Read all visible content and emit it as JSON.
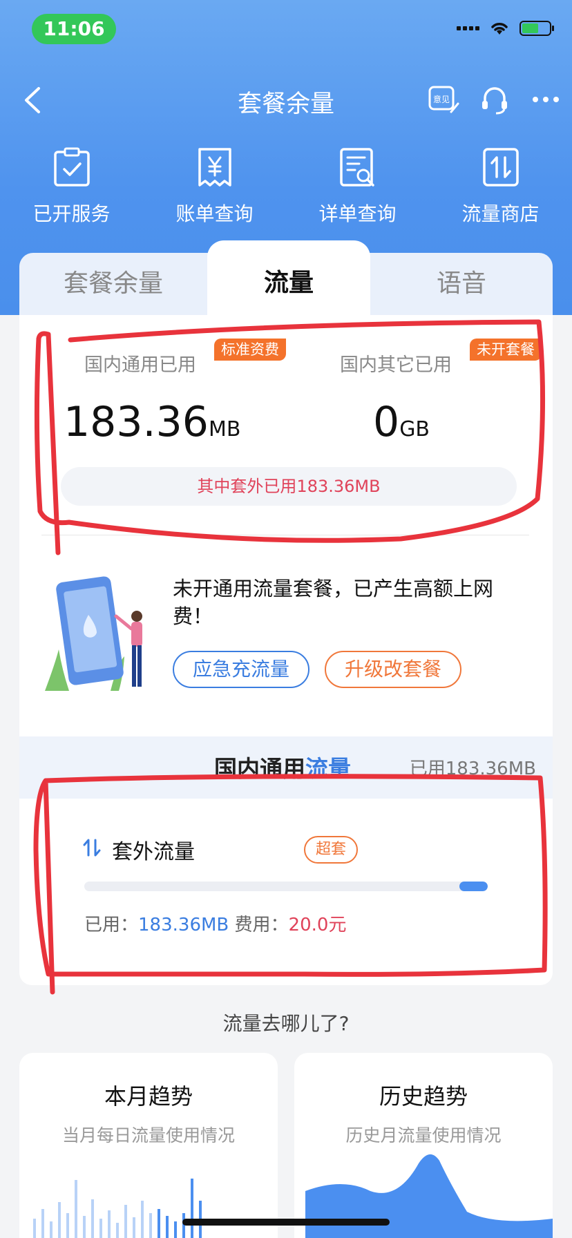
{
  "status_bar": {
    "time": "11:06"
  },
  "nav": {
    "title": "套餐余量",
    "feedback_icon_text": "意见"
  },
  "quick_services": [
    {
      "label": "已开服务",
      "icon": "clipboard-check-icon"
    },
    {
      "label": "账单查询",
      "icon": "bill-yen-icon"
    },
    {
      "label": "详单查询",
      "icon": "detail-search-icon"
    },
    {
      "label": "流量商店",
      "icon": "data-store-icon"
    }
  ],
  "tabs": [
    {
      "label": "套餐余量",
      "active": false
    },
    {
      "label": "流量",
      "active": true
    },
    {
      "label": "语音",
      "active": false
    }
  ],
  "usage": {
    "domestic_general": {
      "label": "国内通用已用",
      "badge": "标准资费",
      "value": "183.36",
      "unit": "MB"
    },
    "domestic_other": {
      "label": "国内其它已用",
      "badge": "未开套餐",
      "value": "0",
      "unit": "GB"
    },
    "overuse_note": "其中套外已用183.36MB"
  },
  "promo": {
    "text": "未开通用流量套餐，已产生高额上网费！",
    "emergency_button": "应急充流量",
    "upgrade_button": "升级改套餐"
  },
  "section": {
    "title_prefix": "国内通用",
    "title_accent": "流量",
    "used": "已用183.36MB"
  },
  "package": {
    "name": "套外流量",
    "badge": "超套",
    "used_label": "已用：",
    "used_value": "183.36MB",
    "fee_label": "费用：",
    "fee_value": "20.0元",
    "progress": 0.07
  },
  "where": {
    "title": "流量去哪儿了?"
  },
  "trends": [
    {
      "title": "本月趋势",
      "subtitle": "当月每日流量使用情况"
    },
    {
      "title": "历史趋势",
      "subtitle": "历史月流量使用情况"
    }
  ],
  "colors": {
    "header_blue": "#4f93ee",
    "accent_blue": "#3a7de0",
    "accent_orange": "#f0773a",
    "alert_red": "#e0435a",
    "annotation_red": "#e8333c"
  }
}
